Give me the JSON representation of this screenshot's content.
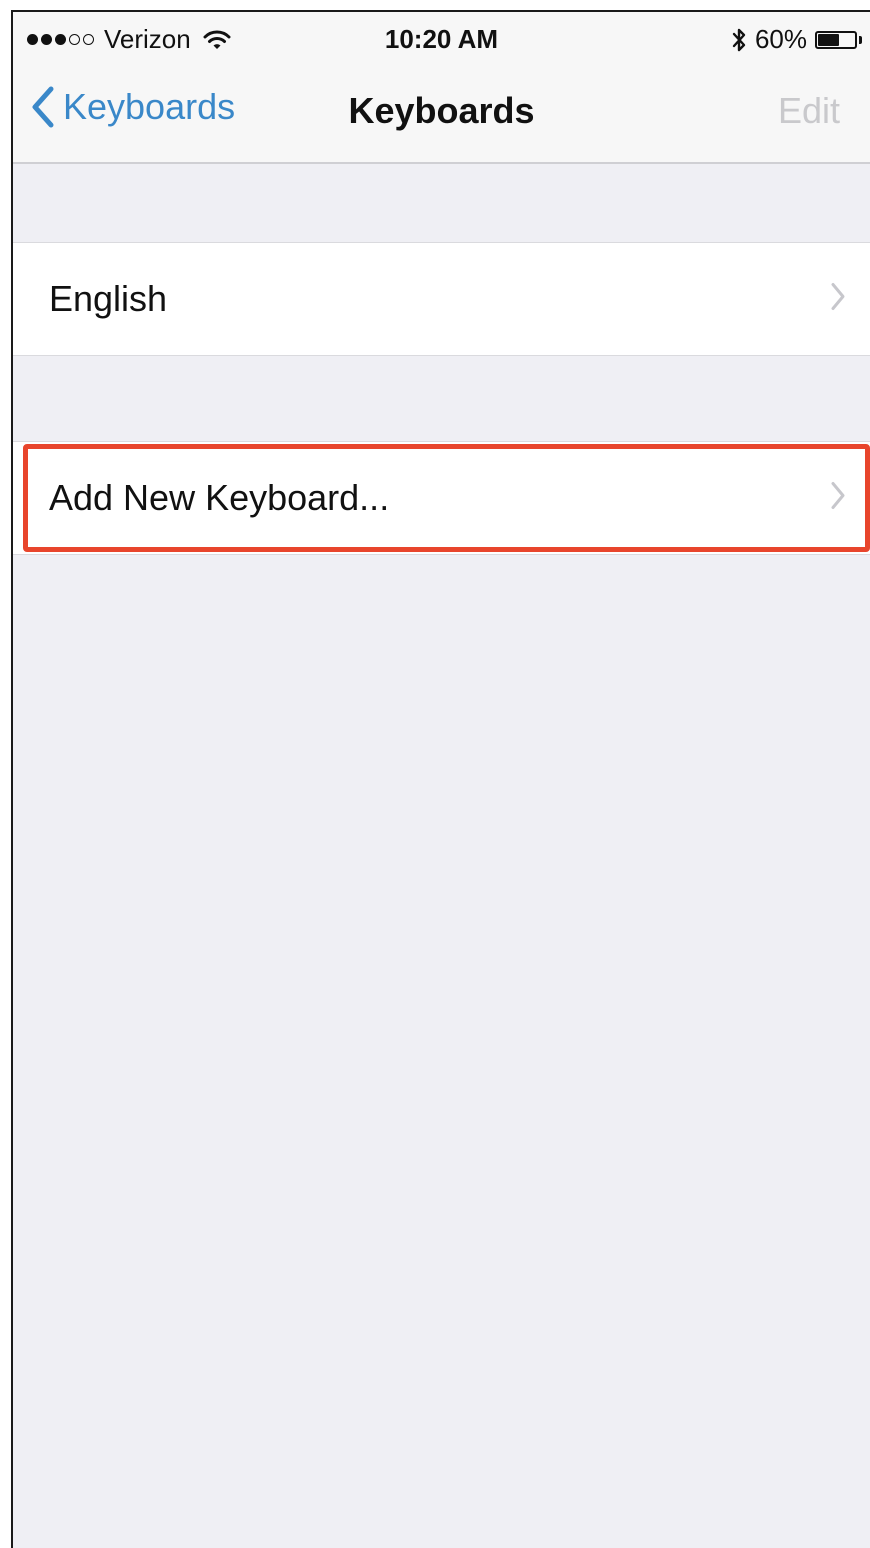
{
  "status_bar": {
    "signal_strength": 3,
    "signal_max": 5,
    "carrier": "Verizon",
    "wifi_icon": "wifi-icon",
    "time": "10:20 AM",
    "bluetooth_icon": "bluetooth-icon",
    "battery_percent_text": "60%",
    "battery_level": 0.6
  },
  "nav": {
    "back_label": "Keyboards",
    "title": "Keyboards",
    "edit_label": "Edit",
    "accent_color": "#3a88c9",
    "disabled_color": "#c9c9cc"
  },
  "sections": {
    "keyboards": {
      "items": [
        {
          "label": "English"
        }
      ]
    },
    "add": {
      "label": "Add New Keyboard...",
      "highlight_color": "#e8452c"
    }
  }
}
